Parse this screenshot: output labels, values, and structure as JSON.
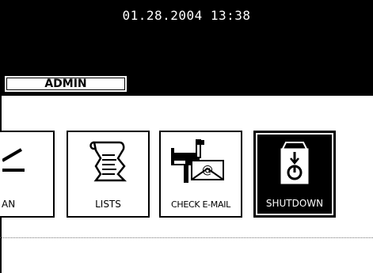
{
  "header": {
    "datetime": "01.28.2004 13:38",
    "tab_label": "ADMIN"
  },
  "buttons": [
    {
      "label": "AN",
      "icon": "scan-icon"
    },
    {
      "label": "LISTS",
      "icon": "document-list-icon"
    },
    {
      "label": "CHECK E-MAIL",
      "icon": "mailbox-email-icon"
    },
    {
      "label": "SHUTDOWN",
      "icon": "power-shutdown-icon"
    }
  ],
  "colors": {
    "background": "#ffffff",
    "header": "#000000",
    "selected_button": "#000000",
    "text": "#000000"
  }
}
